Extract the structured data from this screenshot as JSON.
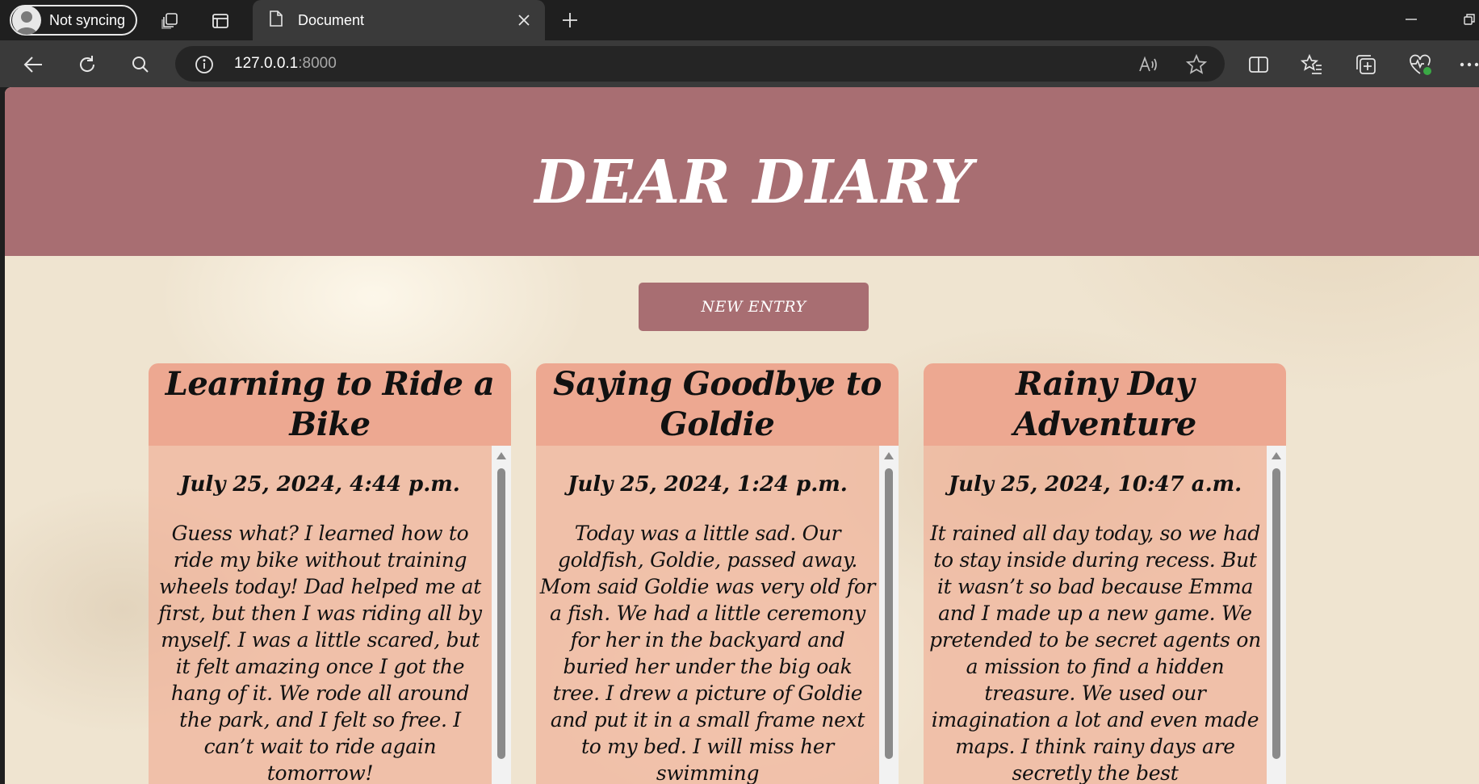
{
  "browser": {
    "profile_label": "Not syncing",
    "tab_title": "Document",
    "url_host": "127.0.0.1",
    "url_port": ":8000"
  },
  "page": {
    "site_title": "DEAR DIARY",
    "new_entry_label": "NEW ENTRY",
    "accent_color": "#a86e72",
    "card_color": "#eda891",
    "entries": [
      {
        "title": "Learning to Ride a Bike",
        "date": "July 25, 2024, 4:44 p.m.",
        "content": "Guess what? I learned how to ride my bike without training wheels today! Dad helped me at first, but then I was riding all by myself. I was a little scared, but it felt amazing once I got the hang of it. We rode all around the park, and I felt so free. I can’t wait to ride again tomorrow!"
      },
      {
        "title": "Saying Goodbye to Goldie",
        "date": "July 25, 2024, 1:24 p.m.",
        "content": "Today was a little sad. Our goldfish, Goldie, passed away. Mom said Goldie was very old for a fish. We had a little ceremony for her in the backyard and buried her under the big oak tree. I drew a picture of Goldie and put it in a small frame next to my bed. I will miss her swimming"
      },
      {
        "title": "Rainy Day Adventure",
        "date": "July 25, 2024, 10:47 a.m.",
        "content": "It rained all day today, so we had to stay inside during recess. But it wasn’t so bad because Emma and I made up a new game. We pretended to be secret agents on a mission to find a hidden treasure. We used our imagination a lot and even made maps. I think rainy days are secretly the best"
      }
    ]
  }
}
